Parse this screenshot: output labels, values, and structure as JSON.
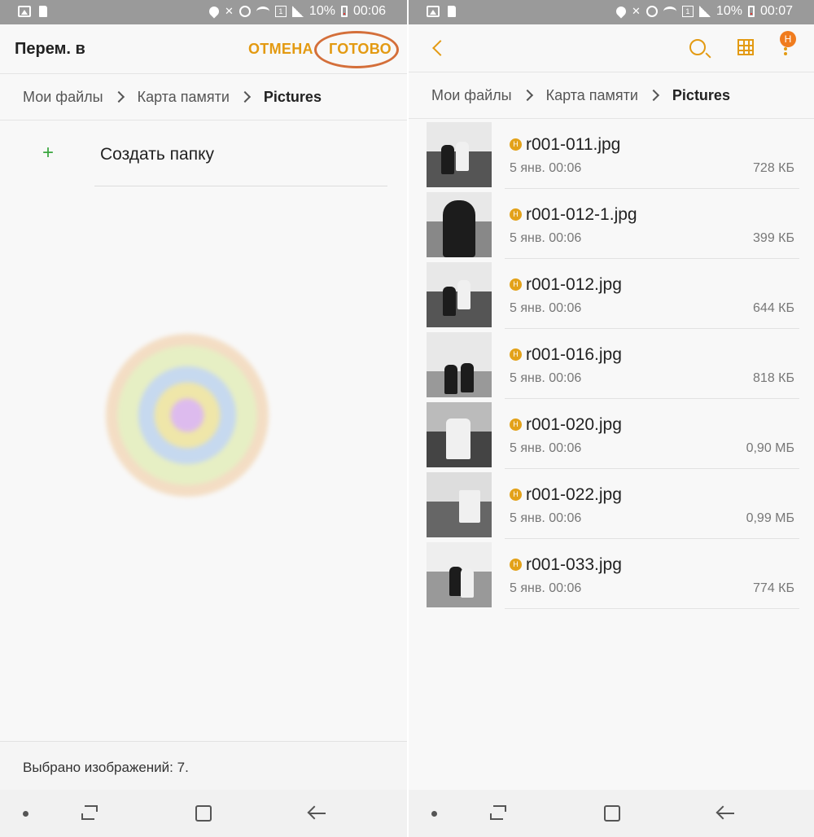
{
  "left": {
    "status": {
      "battery": "10%",
      "time": "00:06",
      "sim": "1"
    },
    "header": {
      "title": "Перем. в",
      "cancel_label": "ОТМЕНА",
      "done_label": "ГОТОВО"
    },
    "breadcrumb": [
      "Мои файлы",
      "Карта памяти",
      "Pictures"
    ],
    "create_folder": {
      "icon": "plus-icon",
      "label": "Создать папку"
    },
    "selected_text": "Выбрано изображений: 7."
  },
  "right": {
    "status": {
      "battery": "10%",
      "time": "00:07",
      "sim": "1"
    },
    "header": {
      "icons": [
        "back-icon",
        "search-icon",
        "grid-view-icon",
        "more-options-icon"
      ],
      "badge": "H"
    },
    "breadcrumb": [
      "Мои файлы",
      "Карта памяти",
      "Pictures"
    ],
    "files": [
      {
        "badge": "H",
        "name": "r001-011.jpg",
        "date": "5 янв. 00:06",
        "size": "728 КБ"
      },
      {
        "badge": "H",
        "name": "r001-012-1.jpg",
        "date": "5 янв. 00:06",
        "size": "399 КБ"
      },
      {
        "badge": "H",
        "name": "r001-012.jpg",
        "date": "5 янв. 00:06",
        "size": "644 КБ"
      },
      {
        "badge": "H",
        "name": "r001-016.jpg",
        "date": "5 янв. 00:06",
        "size": "818 КБ"
      },
      {
        "badge": "H",
        "name": "r001-020.jpg",
        "date": "5 янв. 00:06",
        "size": "0,90 МБ"
      },
      {
        "badge": "H",
        "name": "r001-022.jpg",
        "date": "5 янв. 00:06",
        "size": "0,99 МБ"
      },
      {
        "badge": "H",
        "name": "r001-033.jpg",
        "date": "5 янв. 00:06",
        "size": "774 КБ"
      }
    ]
  },
  "colors": {
    "accent": "#e39a12",
    "plus": "#3aa63f",
    "highlight_ring": "#d46f3a",
    "statusbar": "#9a9a9a"
  }
}
